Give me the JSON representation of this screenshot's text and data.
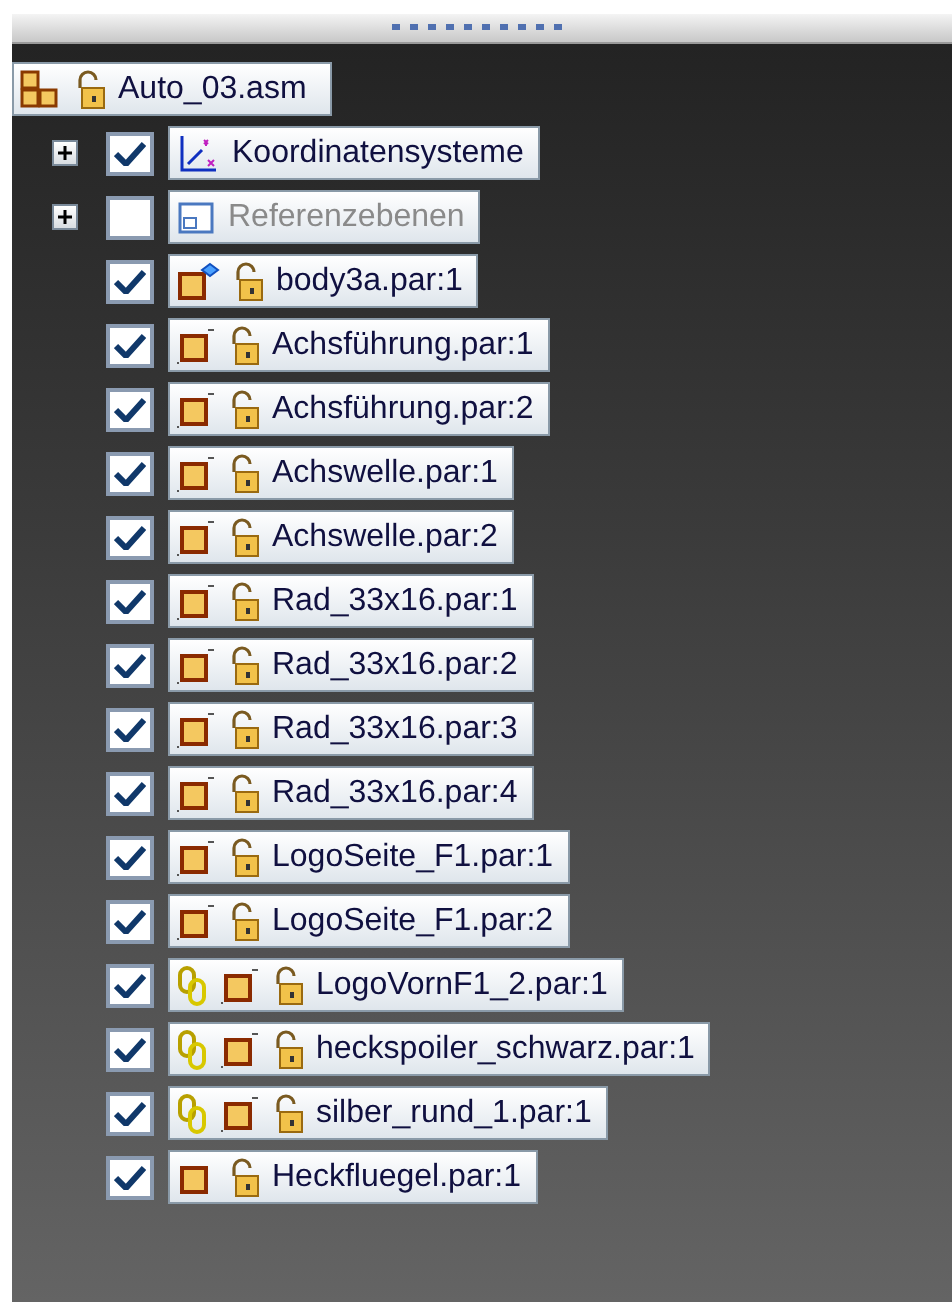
{
  "tree": {
    "label": "Auto_03.asm",
    "kind": "assembly",
    "children": [
      {
        "label": "Koordinatensysteme",
        "kind": "coordinates",
        "expanded": false,
        "checked": true,
        "disabled": false
      },
      {
        "label": "Referenzebenen",
        "kind": "planes",
        "expanded": false,
        "checked": false,
        "disabled": true
      },
      {
        "label": "body3a.par:1",
        "kind": "body",
        "checked": true,
        "disabled": false
      },
      {
        "label": "Achsführung.par:1",
        "kind": "part",
        "checked": true,
        "disabled": false
      },
      {
        "label": "Achsführung.par:2",
        "kind": "part",
        "checked": true,
        "disabled": false
      },
      {
        "label": "Achswelle.par:1",
        "kind": "part",
        "checked": true,
        "disabled": false
      },
      {
        "label": "Achswelle.par:2",
        "kind": "part",
        "checked": true,
        "disabled": false
      },
      {
        "label": "Rad_33x16.par:1",
        "kind": "part",
        "checked": true,
        "disabled": false
      },
      {
        "label": "Rad_33x16.par:2",
        "kind": "part",
        "checked": true,
        "disabled": false
      },
      {
        "label": "Rad_33x16.par:3",
        "kind": "part",
        "checked": true,
        "disabled": false
      },
      {
        "label": "Rad_33x16.par:4",
        "kind": "part",
        "checked": true,
        "disabled": false
      },
      {
        "label": "LogoSeite_F1.par:1",
        "kind": "part",
        "checked": true,
        "disabled": false
      },
      {
        "label": "LogoSeite_F1.par:2",
        "kind": "part",
        "checked": true,
        "disabled": false
      },
      {
        "label": "LogoVornF1_2.par:1",
        "kind": "linked",
        "checked": true,
        "disabled": false
      },
      {
        "label": "heckspoiler_schwarz.par:1",
        "kind": "linked",
        "checked": true,
        "disabled": false
      },
      {
        "label": "silber_rund_1.par:1",
        "kind": "linked",
        "checked": true,
        "disabled": false
      },
      {
        "label": "Heckfluegel.par:1",
        "kind": "simple",
        "checked": true,
        "disabled": false
      }
    ]
  }
}
